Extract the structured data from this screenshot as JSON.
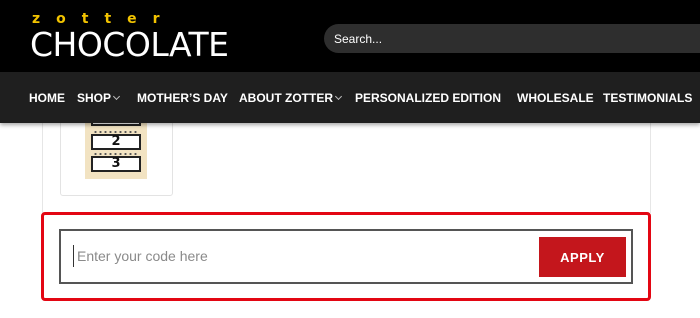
{
  "header": {
    "logo_top": "zotter",
    "logo_main": "CHOCOLATE",
    "search_placeholder": "Search..."
  },
  "nav": {
    "items": [
      {
        "label": "HOME"
      },
      {
        "label": "SHOP",
        "dropdown": true
      },
      {
        "label": "MOTHER’S DAY"
      },
      {
        "label": "ABOUT ZOTTER",
        "dropdown": true
      },
      {
        "label": "PERSONALIZED EDITION"
      },
      {
        "label": "WHOLESALE"
      },
      {
        "label": "TESTIMONIALS"
      }
    ]
  },
  "thumbnail": {
    "frames": [
      "2",
      "3"
    ]
  },
  "coupon": {
    "placeholder": "Enter your code here",
    "apply_label": "APPLY"
  },
  "colors": {
    "header_bg": "#000000",
    "nav_bg": "#1f1f1f",
    "logo_accent": "#f2c300",
    "apply_button": "#c4161c",
    "highlight_border": "#e30613"
  }
}
